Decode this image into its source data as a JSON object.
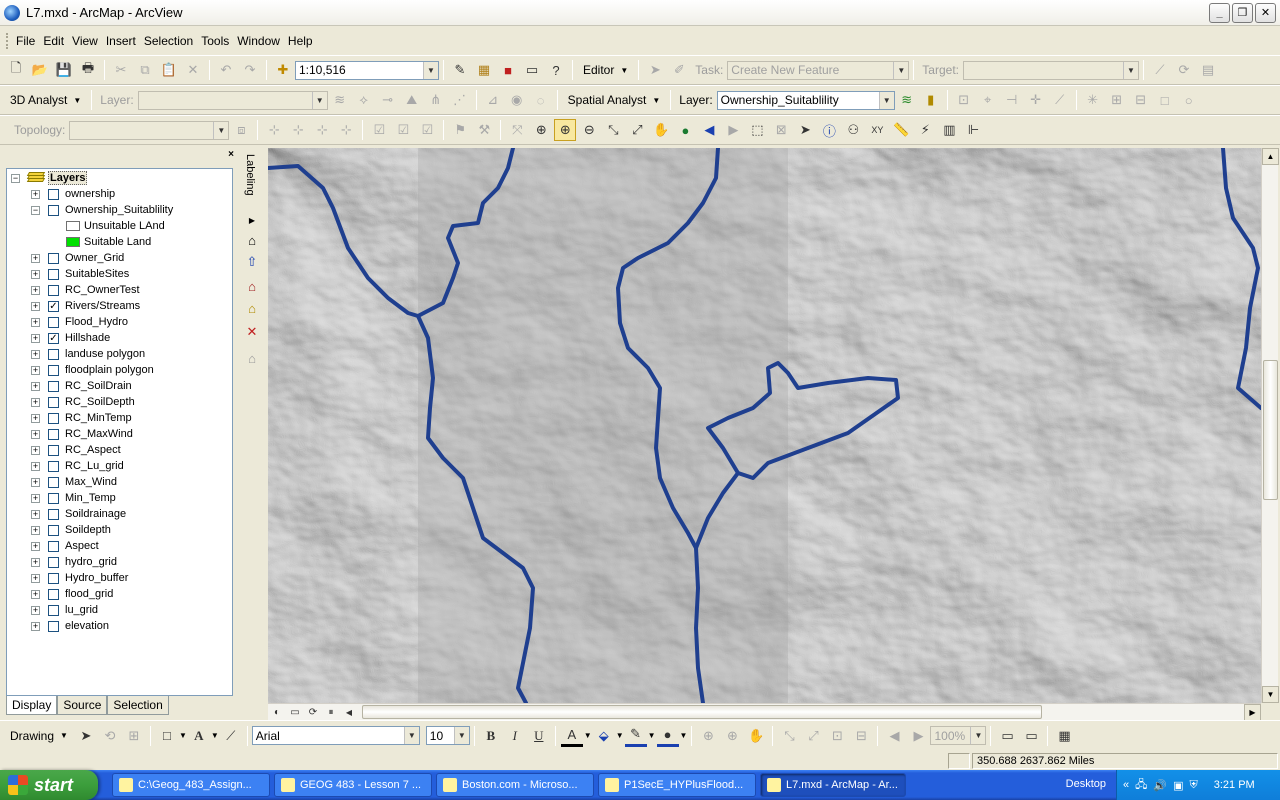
{
  "window": {
    "title": "L7.mxd - ArcMap - ArcView",
    "min": "_",
    "max": "❐",
    "close": "✕"
  },
  "menu": [
    "File",
    "Edit",
    "View",
    "Insert",
    "Selection",
    "Tools",
    "Window",
    "Help"
  ],
  "standard_toolbar": {
    "scale": "1:10,516",
    "editor_label": "Editor",
    "task_label": "Task:",
    "task_value": "Create New Feature",
    "target_label": "Target:"
  },
  "analyst_toolbar": {
    "analyst_3d": "3D Analyst",
    "layer_label_1": "Layer:",
    "spatial_analyst": "Spatial Analyst",
    "layer_label_2": "Layer:",
    "layer_value": "Ownership_Suitablility"
  },
  "topology_toolbar": {
    "topology_label": "Topology:"
  },
  "toc": {
    "close": "×",
    "root": "Layers",
    "layers": [
      {
        "name": "ownership",
        "checked": false,
        "expanded": false
      },
      {
        "name": "Ownership_Suitablility",
        "checked": false,
        "expanded": true
      },
      {
        "name": "Unsuitable LAnd",
        "legend": true,
        "color": "#ffffff"
      },
      {
        "name": "Suitable Land",
        "legend": true,
        "color": "#00e000"
      },
      {
        "name": "Owner_Grid",
        "checked": false,
        "expanded": false
      },
      {
        "name": "SuitableSites",
        "checked": false,
        "expanded": false
      },
      {
        "name": "RC_OwnerTest",
        "checked": false,
        "expanded": false
      },
      {
        "name": "Rivers/Streams",
        "checked": true,
        "expanded": false
      },
      {
        "name": "Flood_Hydro",
        "checked": false,
        "expanded": false
      },
      {
        "name": "Hillshade",
        "checked": true,
        "expanded": false
      },
      {
        "name": "landuse polygon",
        "checked": false,
        "expanded": false
      },
      {
        "name": "floodplain polygon",
        "checked": false,
        "expanded": false
      },
      {
        "name": "RC_SoilDrain",
        "checked": false,
        "expanded": false
      },
      {
        "name": "RC_SoilDepth",
        "checked": false,
        "expanded": false
      },
      {
        "name": "RC_MinTemp",
        "checked": false,
        "expanded": false
      },
      {
        "name": "RC_MaxWind",
        "checked": false,
        "expanded": false
      },
      {
        "name": "RC_Aspect",
        "checked": false,
        "expanded": false
      },
      {
        "name": "RC_Lu_grid",
        "checked": false,
        "expanded": false
      },
      {
        "name": "Max_Wind",
        "checked": false,
        "expanded": false
      },
      {
        "name": "Min_Temp",
        "checked": false,
        "expanded": false
      },
      {
        "name": "Soildrainage",
        "checked": false,
        "expanded": false
      },
      {
        "name": "Soildepth",
        "checked": false,
        "expanded": false
      },
      {
        "name": "Aspect",
        "checked": false,
        "expanded": false
      },
      {
        "name": "hydro_grid",
        "checked": false,
        "expanded": false
      },
      {
        "name": "Hydro_buffer",
        "checked": false,
        "expanded": false
      },
      {
        "name": "flood_grid",
        "checked": false,
        "expanded": false
      },
      {
        "name": "lu_grid",
        "checked": false,
        "expanded": false
      },
      {
        "name": "elevation",
        "checked": false,
        "expanded": false
      }
    ],
    "tabs": [
      "Display",
      "Source",
      "Selection"
    ]
  },
  "labeling": "Labeling",
  "drawing_toolbar": {
    "drawing_label": "Drawing",
    "font": "Arial",
    "size": "10",
    "bold": "B",
    "italic": "I",
    "underline": "U",
    "zoom": "100%"
  },
  "status": {
    "coords": "350.688  2637.862 Miles"
  },
  "taskbar": {
    "start": "start",
    "tasks": [
      {
        "label": "C:\\Geog_483_Assign...",
        "active": false
      },
      {
        "label": "GEOG 483 - Lesson 7 ...",
        "active": false
      },
      {
        "label": "Boston.com - Microso...",
        "active": false
      },
      {
        "label": "P1SecE_HYPlusFlood...",
        "active": false
      },
      {
        "label": "L7.mxd - ArcMap - Ar...",
        "active": true
      }
    ],
    "desktop": "Desktop",
    "clock": "3:21 PM"
  },
  "colors": {
    "river": "#1f3f8f",
    "suitable": "#00e000"
  }
}
